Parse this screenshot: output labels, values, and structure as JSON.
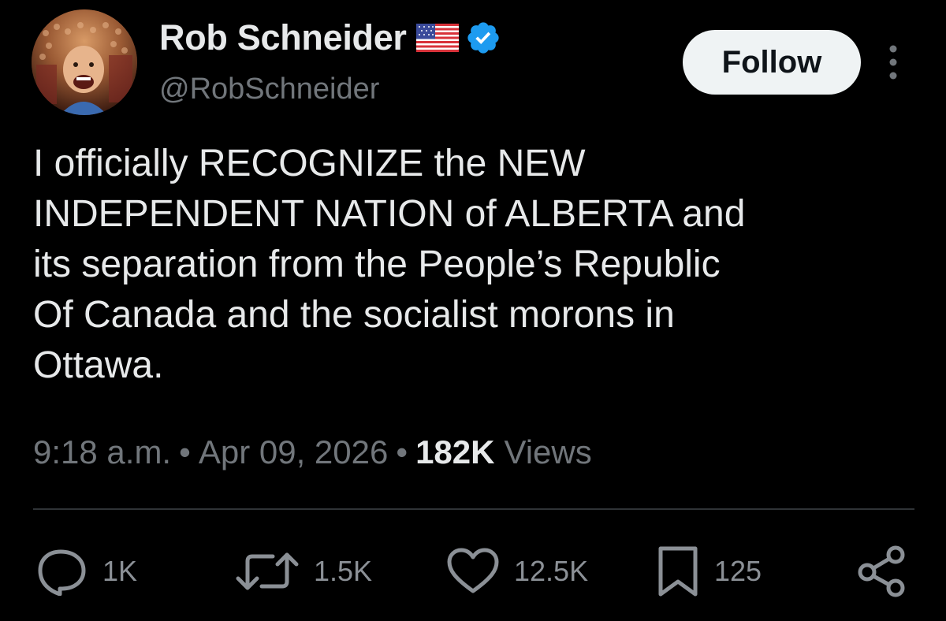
{
  "author": {
    "display_name": "Rob Schneider",
    "handle": "@RobSchneider",
    "flag_icon": "us-flag-icon",
    "verified_icon": "verified-badge-icon",
    "verified_color": "#1d9bf0"
  },
  "header": {
    "follow_label": "Follow",
    "more_icon": "more-vertical-icon"
  },
  "tweet": {
    "text": "I officially RECOGNIZE the NEW\nINDEPENDENT NATION of ALBERTA and\nits separation from the People’s Republic\nOf Canada and the socialist morons in\nOttawa."
  },
  "meta": {
    "time": "9:18 a.m.",
    "separator": "•",
    "date": "Apr 09, 2026",
    "views_count": "182K",
    "views_label": "Views"
  },
  "actions": {
    "reply": {
      "icon": "reply-icon",
      "count": "1K"
    },
    "repost": {
      "icon": "repost-icon",
      "count": "1.5K"
    },
    "like": {
      "icon": "heart-icon",
      "count": "12.5K"
    },
    "bookmark": {
      "icon": "bookmark-icon",
      "count": "125"
    },
    "share": {
      "icon": "share-icon"
    }
  },
  "colors": {
    "background": "#000000",
    "text": "#e7e9ea",
    "secondary": "#71767b",
    "follow_bg": "#eff3f4"
  }
}
